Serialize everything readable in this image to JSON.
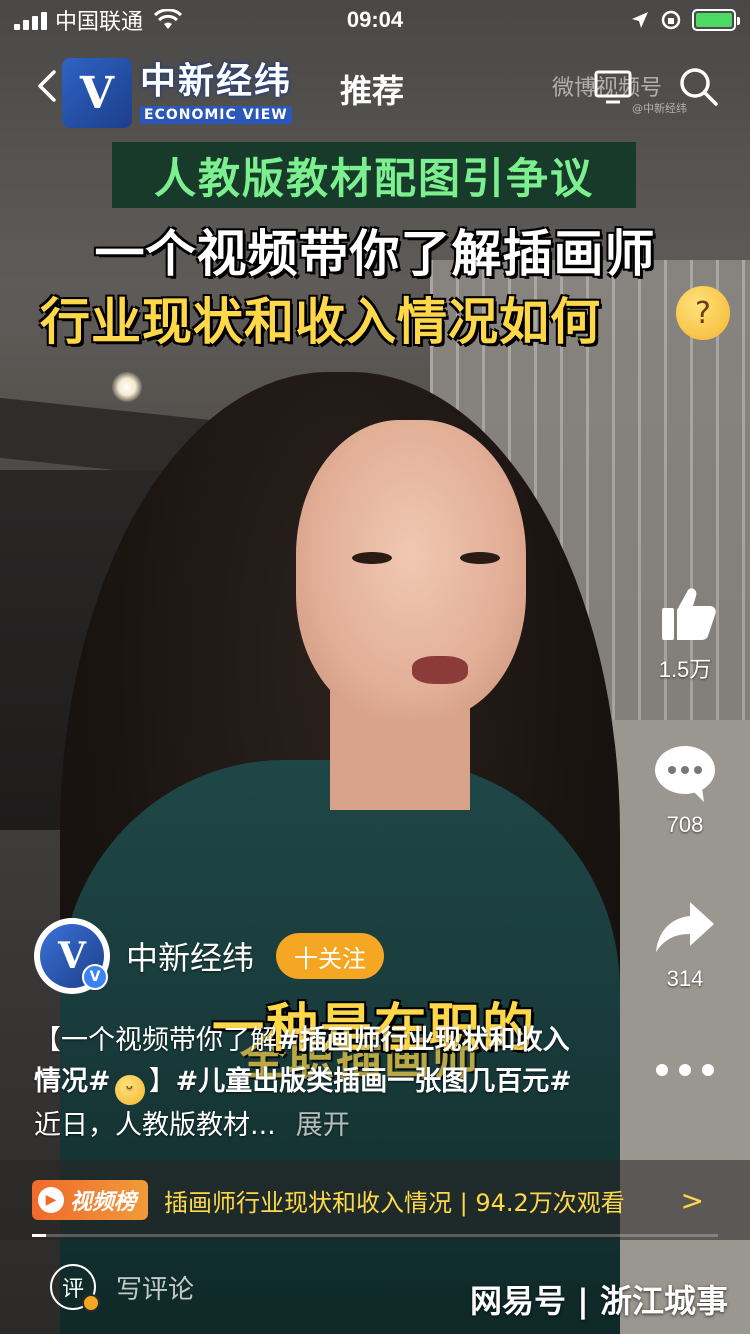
{
  "status_bar": {
    "carrier": "中国联通",
    "time": "09:04"
  },
  "nav": {
    "logo_cn": "中新经纬",
    "logo_en": "ECONOMIC VIEW",
    "title": "推荐",
    "watermark": "微博视频号",
    "watermark_sub": "@中新经纬"
  },
  "captions": {
    "line1": "人教版教材配图引争议",
    "line2": "一个视频带你了解插画师",
    "line3": "行业现状和收入情况如何"
  },
  "actions": {
    "like_count": "1.5万",
    "comment_count": "708",
    "share_count": "314"
  },
  "subtitle": {
    "line1": "一种是在职的",
    "line2": "全职插画师"
  },
  "author": {
    "name": "中新经纬",
    "follow_label": "十关注"
  },
  "description": {
    "part1": "【一个视频带你了解",
    "tag1": "#插画师行业现状和收入情况#",
    "part2": "】",
    "tag2": "#儿童出版类插画一张图几百元#",
    "part3": "近日，人教版教材...",
    "more": "展开"
  },
  "ranking": {
    "badge": "视频榜",
    "text": "插画师行业现状和收入情况 | 94.2万次观看",
    "progress": 0.02
  },
  "comment": {
    "icon_text": "评",
    "placeholder": "写评论"
  },
  "brand": "网易号 | 浙江城事",
  "icons": [
    "back-icon",
    "cast-icon",
    "search-icon",
    "thumbs-up-icon",
    "comment-icon",
    "share-icon",
    "more-icon"
  ]
}
